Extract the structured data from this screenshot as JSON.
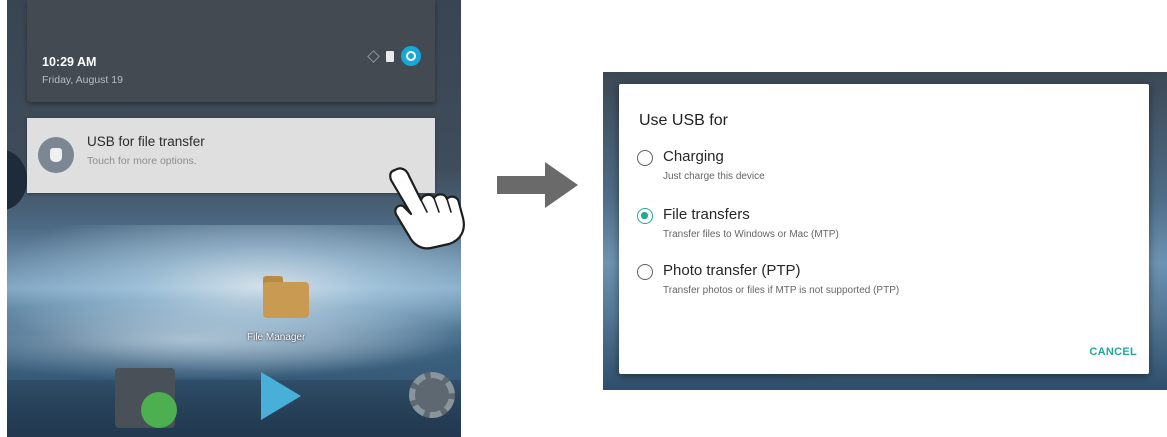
{
  "notification_shade": {
    "time": "10:29 AM",
    "date": "Friday, August 19",
    "notification": {
      "title": "USB for file transfer",
      "subtitle": "Touch for more options."
    }
  },
  "home_screen": {
    "folder_label": "File Manager"
  },
  "dialog": {
    "title": "Use USB for",
    "options": [
      {
        "label": "Charging",
        "description": "Just charge this device",
        "selected": false
      },
      {
        "label": "File transfers",
        "description": "Transfer files to Windows or Mac (MTP)",
        "selected": true
      },
      {
        "label": "Photo transfer (PTP)",
        "description": "Transfer photos or files if MTP is not supported (PTP)",
        "selected": false
      }
    ],
    "cancel_label": "CANCEL"
  },
  "colors": {
    "accent": "#26a69a",
    "status_card": "#434a52",
    "notification_card": "#dfdfdf",
    "arrow": "#6a6a6a"
  },
  "icons": {
    "usb": "usb-icon",
    "user": "user-icon",
    "hand": "hand-pointer-icon",
    "arrow": "arrow-right-icon"
  }
}
